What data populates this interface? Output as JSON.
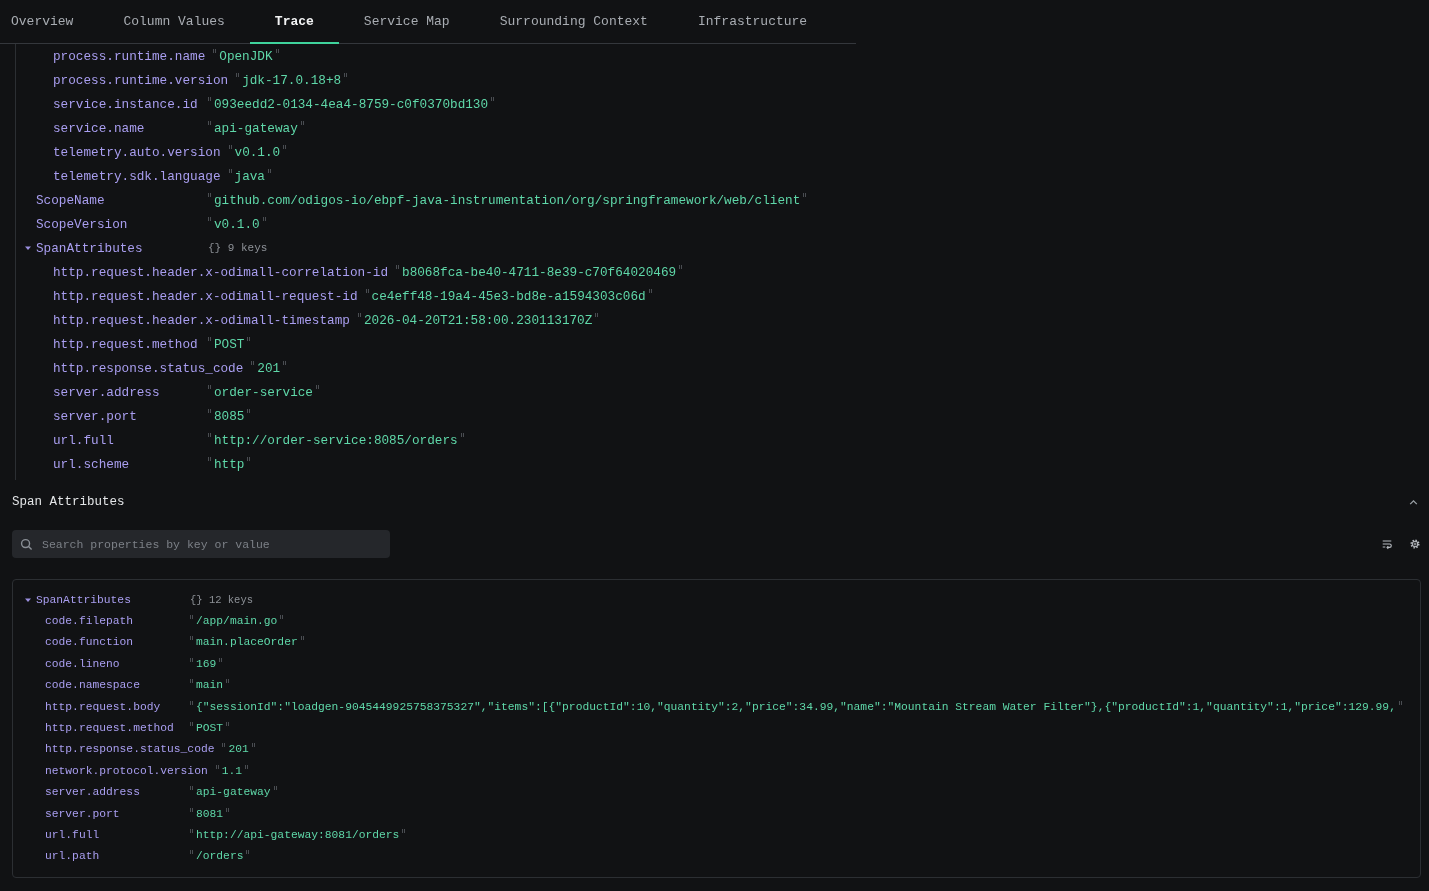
{
  "tabs": [
    {
      "label": "Overview",
      "selected": false
    },
    {
      "label": "Column Values",
      "selected": false
    },
    {
      "label": "Trace",
      "selected": true
    },
    {
      "label": "Service Map",
      "selected": false
    },
    {
      "label": "Surrounding Context",
      "selected": false
    },
    {
      "label": "Infrastructure",
      "selected": false
    }
  ],
  "trace_attributes": [
    {
      "children": [
        {
          "key": "process.runtime.name",
          "value": "OpenJDK"
        },
        {
          "key": "process.runtime.version",
          "value": "jdk-17.0.18+8"
        },
        {
          "key": "service.instance.id",
          "value": "093eedd2-0134-4ea4-8759-c0f0370bd130"
        },
        {
          "key": "service.name",
          "value": "api-gateway"
        },
        {
          "key": "telemetry.auto.version",
          "value": "v0.1.0"
        },
        {
          "key": "telemetry.sdk.language",
          "value": "java"
        }
      ]
    },
    {
      "key": "ScopeName",
      "value": "github.com/odigos-io/ebpf-java-instrumentation/org/springframework/web/client"
    },
    {
      "key": "ScopeVersion",
      "value": "v0.1.0"
    },
    {
      "key": "SpanAttributes",
      "summary": "{} 9 keys",
      "expanded": true,
      "children": [
        {
          "key": "http.request.header.x-odimall-correlation-id",
          "value": "b8068fca-be40-4711-8e39-c70f64020469"
        },
        {
          "key": "http.request.header.x-odimall-request-id",
          "value": "ce4eff48-19a4-45e3-bd8e-a1594303c06d"
        },
        {
          "key": "http.request.header.x-odimall-timestamp",
          "value": "2026-04-20T21:58:00.230113170Z"
        },
        {
          "key": "http.request.method",
          "value": "POST"
        },
        {
          "key": "http.response.status_code",
          "value": "201"
        },
        {
          "key": "server.address",
          "value": "order-service"
        },
        {
          "key": "server.port",
          "value": "8085"
        },
        {
          "key": "url.full",
          "value": "http://order-service:8085/orders"
        },
        {
          "key": "url.scheme",
          "value": "http"
        }
      ]
    }
  ],
  "span_attributes_section": {
    "title": "Span Attributes",
    "expanded": true,
    "search": {
      "placeholder": "Search properties by key or value"
    },
    "tree": [
      {
        "key": "SpanAttributes",
        "summary": "{} 12 keys",
        "expanded": true,
        "children": [
          {
            "key": "code.filepath",
            "value": "/app/main.go"
          },
          {
            "key": "code.function",
            "value": "main.placeOrder"
          },
          {
            "key": "code.lineno",
            "value": "169"
          },
          {
            "key": "code.namespace",
            "value": "main"
          },
          {
            "key": "http.request.body",
            "value": "{\"sessionId\":\"loadgen-9045449925758375327\",\"items\":[{\"productId\":10,\"quantity\":2,\"price\":34.99,\"name\":\"Mountain Stream Water Filter\"},{\"productId\":1,\"quantity\":1,\"price\":129.99,"
          },
          {
            "key": "http.request.method",
            "value": "POST"
          },
          {
            "key": "http.response.status_code",
            "value": "201"
          },
          {
            "key": "network.protocol.version",
            "value": "1.1"
          },
          {
            "key": "server.address",
            "value": "api-gateway"
          },
          {
            "key": "server.port",
            "value": "8081"
          },
          {
            "key": "url.full",
            "value": "http://api-gateway:8081/orders"
          },
          {
            "key": "url.path",
            "value": "/orders"
          }
        ]
      }
    ]
  }
}
